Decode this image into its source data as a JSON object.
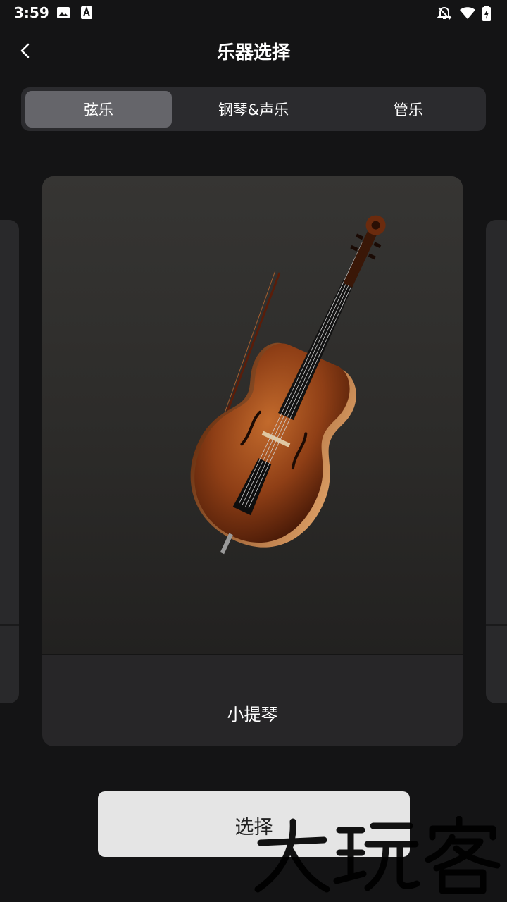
{
  "status_bar": {
    "time": "3:59",
    "icons": [
      "image-icon",
      "font-a-icon",
      "notifications-off-icon",
      "wifi-icon",
      "battery-charging-icon"
    ]
  },
  "header": {
    "back_icon": "chevron-left-icon",
    "title": "乐器选择"
  },
  "tabs": [
    {
      "label": "弦乐",
      "active": true
    },
    {
      "label": "钢琴&声乐",
      "active": false
    },
    {
      "label": "管乐",
      "active": false
    }
  ],
  "carousel": {
    "current_item": {
      "label": "小提琴",
      "image": "cello-illustration"
    }
  },
  "select_button": {
    "label": "选择"
  },
  "watermark": {
    "text": "大玩客"
  },
  "colors": {
    "background": "#141415",
    "tab_bar": "#2b2b2e",
    "tab_active": "#65656a",
    "card": "#272628",
    "button": "#e5e5e5"
  }
}
